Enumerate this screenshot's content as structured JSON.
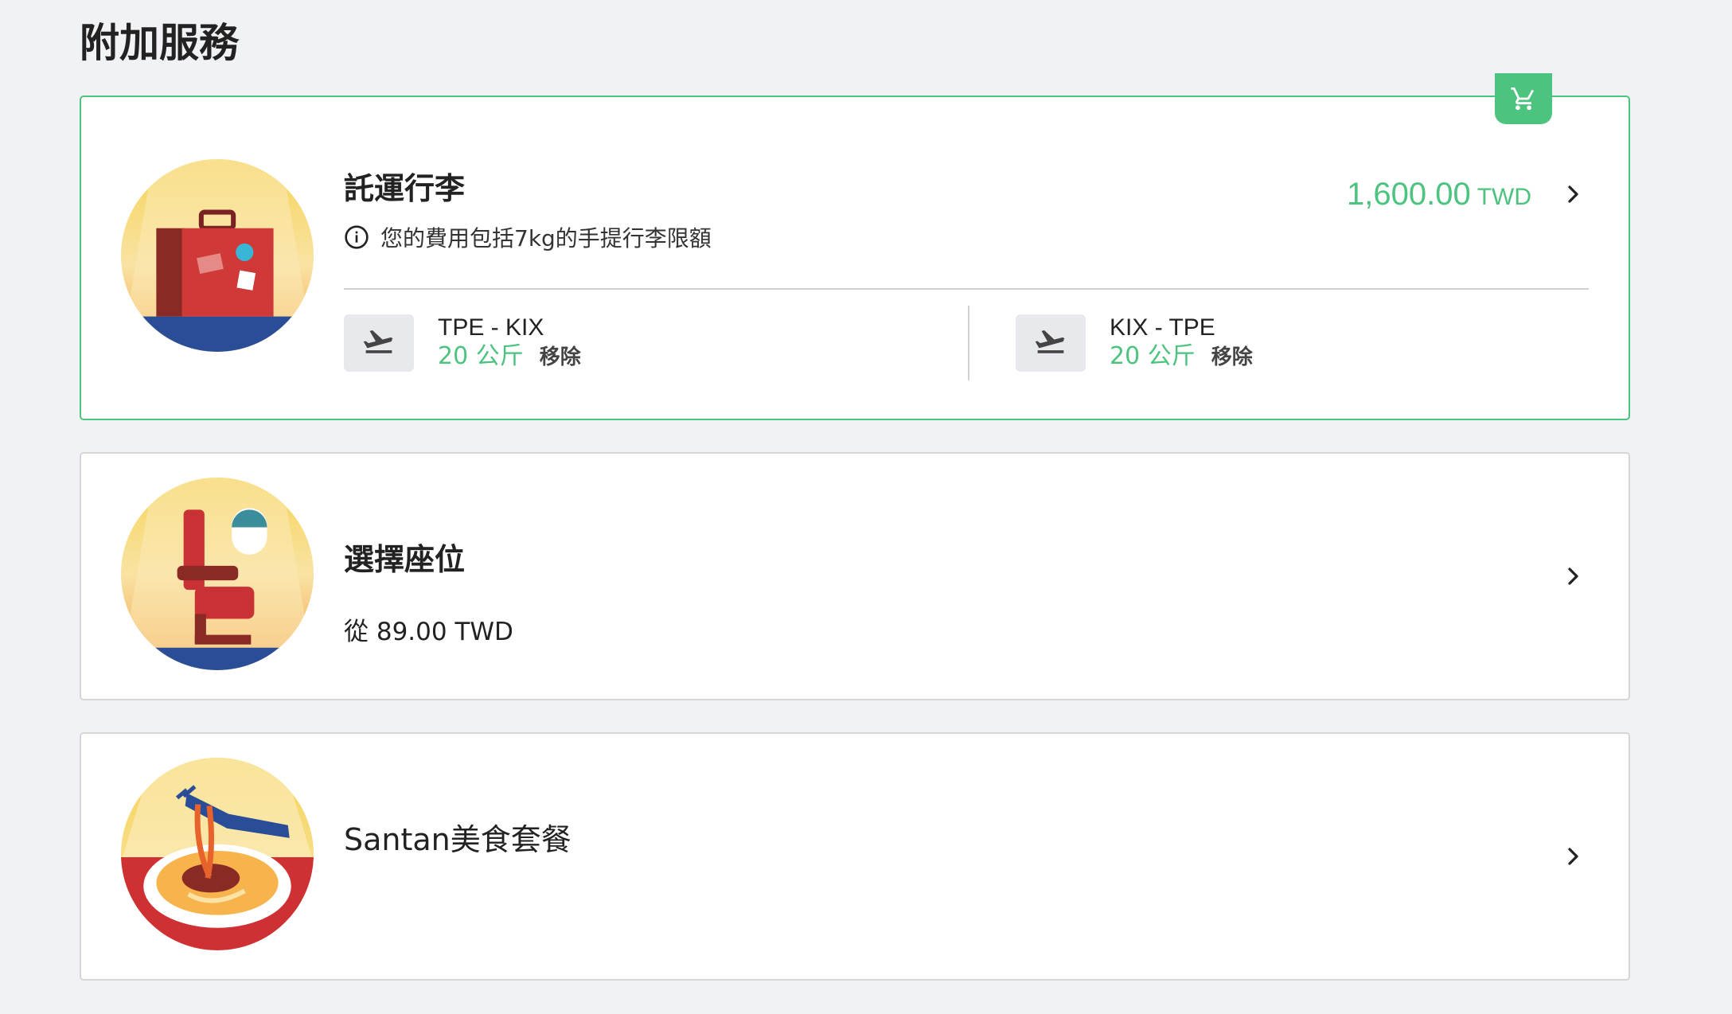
{
  "page": {
    "title": "附加服務"
  },
  "colors": {
    "accent": "#4cc37e",
    "background": "#f0f2f5",
    "border": "#d6d6d6"
  },
  "baggage": {
    "title": "託運行李",
    "note": "您的費用包括7kg的手提行李限額",
    "price": "1,600.00",
    "currency": "TWD",
    "icons": {
      "cart": "cart-icon",
      "info": "info-icon",
      "chevron": "chevron-right-icon",
      "illustration": "suitcase-icon"
    },
    "segments": [
      {
        "route": "TPE - KIX",
        "weight": "20 公斤",
        "remove": "移除",
        "icon": "plane-departure-icon"
      },
      {
        "route": "KIX - TPE",
        "weight": "20 公斤",
        "remove": "移除",
        "icon": "plane-departure-icon"
      }
    ]
  },
  "seat": {
    "title": "選擇座位",
    "from_label": "從 89.00 TWD",
    "icons": {
      "chevron": "chevron-right-icon",
      "illustration": "seat-icon"
    }
  },
  "meal": {
    "title": "Santan美食套餐",
    "icons": {
      "chevron": "chevron-right-icon",
      "illustration": "noodle-plate-icon"
    }
  }
}
